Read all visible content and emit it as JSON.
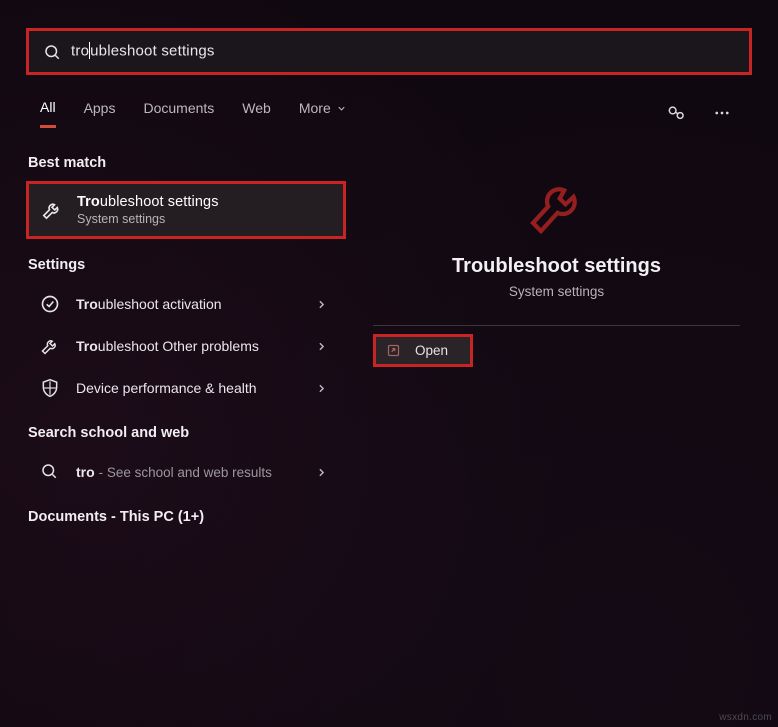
{
  "search": {
    "query": "troubleshoot settings",
    "typed_prefix": "tro"
  },
  "tabs": {
    "all": "All",
    "apps": "Apps",
    "documents": "Documents",
    "web": "Web",
    "more": "More"
  },
  "sections": {
    "best_match": "Best match",
    "settings": "Settings",
    "web": "Search school and web",
    "docs": "Documents - This PC (1+)"
  },
  "best_match": {
    "prefix": "Tro",
    "rest": "ubleshoot settings",
    "subtitle": "System settings"
  },
  "settings_items": [
    {
      "prefix": "Tro",
      "rest": "ubleshoot activation",
      "icon": "check-circle"
    },
    {
      "prefix": "Tro",
      "rest": "ubleshoot Other problems",
      "icon": "wrench"
    },
    {
      "prefix": "",
      "rest": "Device performance & health",
      "icon": "shield"
    }
  ],
  "web_item": {
    "prefix": "tro",
    "hint": "See school and web results"
  },
  "detail": {
    "title": "Troubleshoot settings",
    "subtitle": "System settings",
    "action": "Open"
  },
  "watermark": "wsxdn.com"
}
